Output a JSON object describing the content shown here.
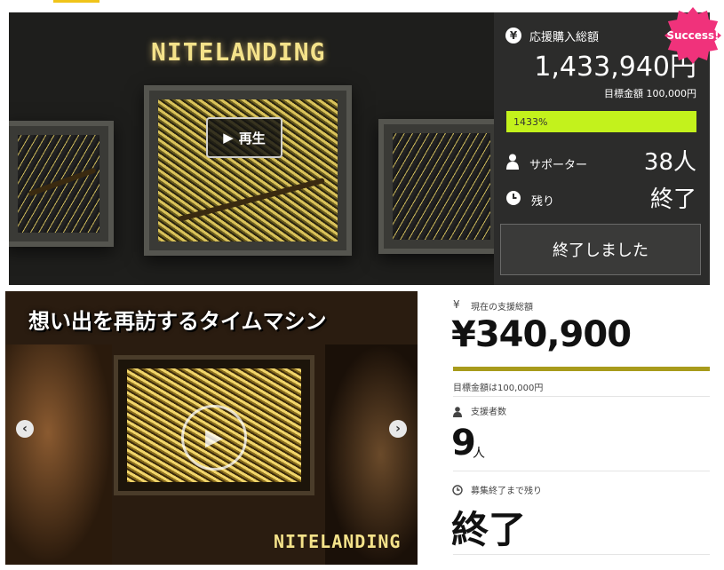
{
  "top": {
    "brand": "NITELANDING",
    "play_label": "再生",
    "panel": {
      "total_label": "応援購入総額",
      "total_amount": "1,433,940円",
      "goal": "目標金額 100,000円",
      "progress_percent": 1433,
      "progress_text": "1433%",
      "supporters_label": "サポーター",
      "supporters_value": "38人",
      "remaining_label": "残り",
      "remaining_value": "終了",
      "ended_button": "終了しました"
    },
    "success_badge": "Success!"
  },
  "bottom": {
    "video_title": "想い出を再訪するタイムマシン",
    "brand": "NITELANDING",
    "panel": {
      "current_total_label": "現在の支援総額",
      "current_total": "¥340,900",
      "goal": "目標金額は100,000円",
      "supporters_label": "支援者数",
      "supporters_count": "9",
      "supporters_unit": "人",
      "remaining_label": "募集終了まで残り",
      "remaining_value": "終了"
    }
  },
  "colors": {
    "accent_green": "#c3f21c",
    "success_pink": "#f0327b",
    "progress_olive": "#a89b1c",
    "panel_dark": "#2c2c2b"
  },
  "icons": [
    "yen-icon",
    "person-icon",
    "clock-icon",
    "play-icon",
    "chevron-left-icon",
    "chevron-right-icon"
  ]
}
